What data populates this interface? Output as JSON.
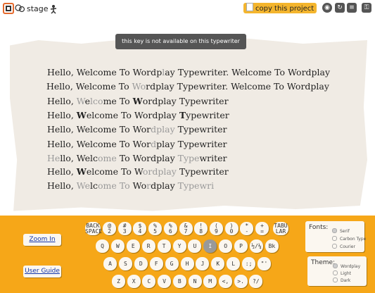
{
  "topbar": {
    "stage_label": "stage",
    "copy_label": "copy this project",
    "icons": [
      "green-flag-icon",
      "sprite-icon",
      "sprite-figure-icon",
      "eye-icon",
      "refresh-icon",
      "menu-icon",
      "lock-icon"
    ]
  },
  "tooltip": "this key is not available on this typewriter",
  "lines": [
    [
      [
        "Hello, Wel",
        ""
      ],
      [
        "c",
        ""
      ],
      [
        "o",
        ""
      ],
      [
        "m",
        ""
      ],
      [
        "e To W",
        ""
      ],
      [
        "or",
        ""
      ],
      [
        "d",
        ""
      ],
      [
        "p",
        ""
      ],
      [
        "l",
        "f"
      ],
      [
        "ay ",
        ""
      ],
      [
        "T",
        ""
      ],
      [
        "y",
        ""
      ],
      [
        "p",
        ""
      ],
      [
        "ewrit",
        ""
      ],
      [
        "er.",
        ""
      ],
      [
        " W",
        ""
      ],
      [
        "e",
        ""
      ],
      [
        "lcome To W",
        ""
      ],
      [
        "o",
        ""
      ],
      [
        "rdplay",
        ""
      ]
    ],
    [
      [
        "Hello, Welc",
        ""
      ],
      [
        "o",
        ""
      ],
      [
        "me To ",
        ""
      ],
      [
        "Wo",
        "f"
      ],
      [
        "rd",
        ""
      ],
      [
        "play Type",
        ""
      ],
      [
        "writer. Welcome To Wordplay",
        ""
      ]
    ],
    [
      [
        "Hello, ",
        ""
      ],
      [
        "W",
        "f"
      ],
      [
        "e",
        ""
      ],
      [
        "lco",
        "f"
      ],
      [
        "me To ",
        ""
      ],
      [
        "W",
        "b"
      ],
      [
        "ordplay Typewriter",
        ""
      ]
    ],
    [
      [
        "Hello, ",
        ""
      ],
      [
        "W",
        "b"
      ],
      [
        "elcome To Wordplay ",
        ""
      ],
      [
        "T",
        "b"
      ],
      [
        "ypewriter",
        ""
      ]
    ],
    [
      [
        "Hello, Welcome To Wor",
        ""
      ],
      [
        "dplay",
        "f"
      ],
      [
        " Typewriter",
        ""
      ]
    ],
    [
      [
        "Hello, Welcome To Wor",
        ""
      ],
      [
        "d",
        "f"
      ],
      [
        "play Typewriter",
        ""
      ]
    ],
    [
      [
        "He",
        "f"
      ],
      [
        "llo, Welc",
        ""
      ],
      [
        "ome",
        "f"
      ],
      [
        " To Wordplay ",
        ""
      ],
      [
        "Type",
        "f"
      ],
      [
        "writer",
        ""
      ]
    ],
    [
      [
        "Hello, ",
        ""
      ],
      [
        "W",
        "b"
      ],
      [
        "elcome To W",
        ""
      ],
      [
        "ordplay",
        "f"
      ],
      [
        " Typewriter",
        ""
      ]
    ],
    [
      [
        "Hello, ",
        ""
      ],
      [
        "We",
        "f"
      ],
      [
        "lc",
        ""
      ],
      [
        "ome To",
        "f"
      ],
      [
        " Wo",
        ""
      ],
      [
        "r",
        "f"
      ],
      [
        "dplay ",
        ""
      ],
      [
        "Typewri",
        "f"
      ]
    ]
  ],
  "sidebar": {
    "zoom_label": "Zoom In",
    "guide_label": "User Guide"
  },
  "keyboard": {
    "row1": [
      {
        "top": "BACK",
        "bot": "SPACE"
      },
      {
        "top": "@",
        "bot": "2"
      },
      {
        "top": "#",
        "bot": "3"
      },
      {
        "top": "$",
        "bot": "4"
      },
      {
        "top": "%",
        "bot": "5"
      },
      {
        "top": "%",
        "bot": "6"
      },
      {
        "top": "&",
        "bot": "7"
      },
      {
        "top": "!",
        "bot": "8"
      },
      {
        "top": "(",
        "bot": "9"
      },
      {
        "top": ")",
        "bot": "0"
      },
      {
        "top": "*",
        "bot": "-"
      },
      {
        "top": "+",
        "bot": "="
      },
      {
        "top": "TABU",
        "bot": "LAR"
      }
    ],
    "row2": [
      "Q",
      "W",
      "E",
      "R",
      "T",
      "Y",
      "U",
      "I",
      "O",
      "P",
      "½/¼",
      "Bk"
    ],
    "row3": [
      "A",
      "S",
      "D",
      "F",
      "G",
      "H",
      "J",
      "K",
      "L",
      ":;",
      "\"'"
    ],
    "row4": [
      "Z",
      "X",
      "C",
      "V",
      "B",
      "N",
      "M",
      "<,",
      ">.",
      "?/"
    ]
  },
  "fonts": {
    "title": "Fonts:",
    "options": [
      "Serif",
      "Carbon Type",
      "Courier"
    ],
    "selected": "Serif"
  },
  "theme": {
    "title": "Theme:",
    "options": [
      "Wordplay",
      "Light",
      "Dark"
    ],
    "selected": "Wordplay"
  }
}
